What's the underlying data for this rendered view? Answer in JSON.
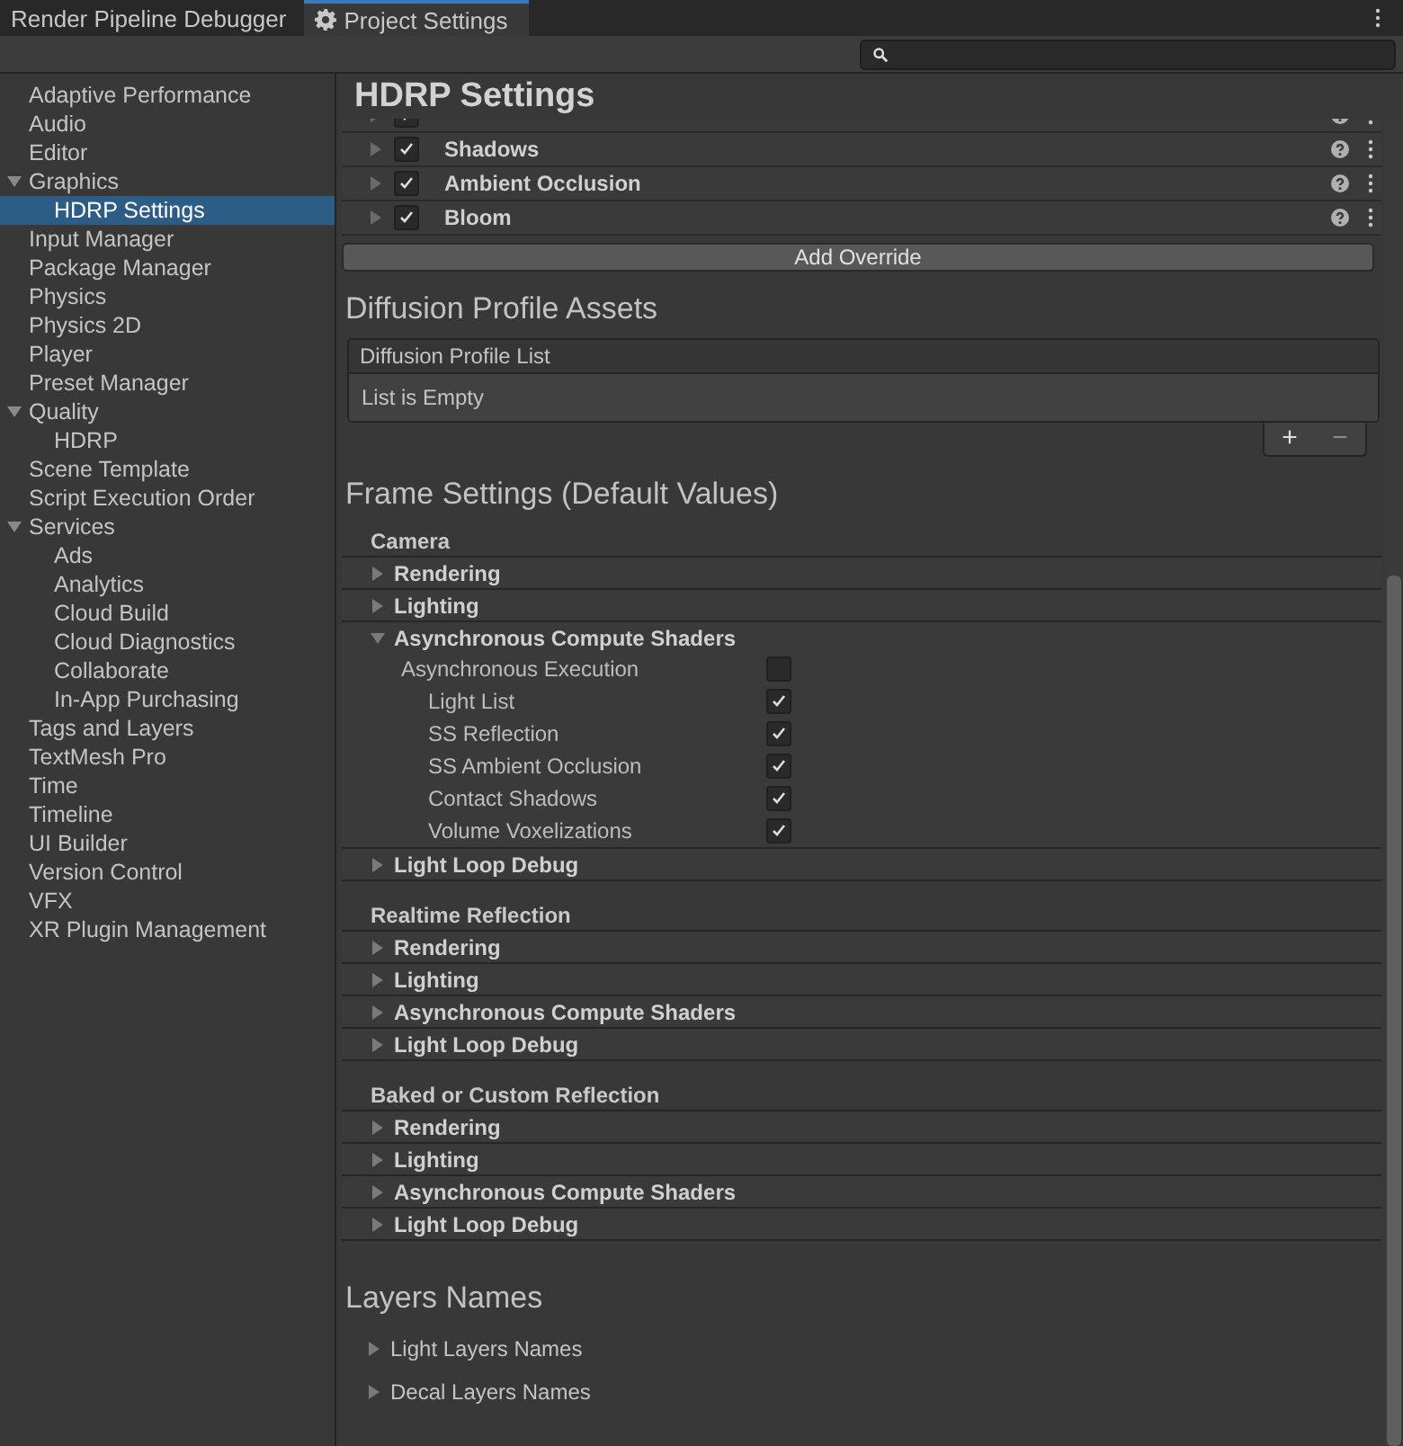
{
  "tabs": [
    {
      "label": "Render Pipeline Debugger",
      "selected": false,
      "kind": "plain"
    },
    {
      "label": "Project Settings",
      "selected": true,
      "kind": "settings"
    }
  ],
  "sidebar": {
    "items": [
      {
        "label": "Adaptive Performance",
        "selected": false
      },
      {
        "label": "Audio",
        "selected": false
      },
      {
        "label": "Editor",
        "selected": false
      },
      {
        "label": "Graphics",
        "selected": false,
        "expanded": true,
        "children": [
          {
            "label": "HDRP Settings",
            "selected": true
          }
        ]
      },
      {
        "label": "Input Manager",
        "selected": false
      },
      {
        "label": "Package Manager",
        "selected": false
      },
      {
        "label": "Physics",
        "selected": false
      },
      {
        "label": "Physics 2D",
        "selected": false
      },
      {
        "label": "Player",
        "selected": false
      },
      {
        "label": "Preset Manager",
        "selected": false
      },
      {
        "label": "Quality",
        "selected": false,
        "expanded": true,
        "children": [
          {
            "label": "HDRP",
            "selected": false
          }
        ]
      },
      {
        "label": "Scene Template",
        "selected": false
      },
      {
        "label": "Script Execution Order",
        "selected": false
      },
      {
        "label": "Services",
        "selected": false,
        "expanded": true,
        "children": [
          {
            "label": "Ads",
            "selected": false
          },
          {
            "label": "Analytics",
            "selected": false
          },
          {
            "label": "Cloud Build",
            "selected": false
          },
          {
            "label": "Cloud Diagnostics",
            "selected": false
          },
          {
            "label": "Collaborate",
            "selected": false
          },
          {
            "label": "In-App Purchasing",
            "selected": false
          }
        ]
      },
      {
        "label": "Tags and Layers",
        "selected": false
      },
      {
        "label": "TextMesh Pro",
        "selected": false
      },
      {
        "label": "Time",
        "selected": false
      },
      {
        "label": "Timeline",
        "selected": false
      },
      {
        "label": "UI Builder",
        "selected": false
      },
      {
        "label": "Version Control",
        "selected": false
      },
      {
        "label": "VFX",
        "selected": false
      },
      {
        "label": "XR Plugin Management",
        "selected": false
      }
    ]
  },
  "page_title": "HDRP Settings",
  "overrides": [
    {
      "checked": true,
      "kind": "clipped"
    },
    {
      "label": "Shadows",
      "checked": true,
      "kind": "full"
    },
    {
      "label": "Ambient Occlusion",
      "checked": true,
      "kind": "full"
    },
    {
      "label": "Bloom",
      "checked": true,
      "kind": "full"
    }
  ],
  "add_override": "Add Override",
  "diffusion": {
    "title": "Diffusion Profile Assets",
    "list_header": "Diffusion Profile List",
    "empty_text": "List is Empty",
    "add": "+",
    "remove": "−"
  },
  "frame_settings": {
    "title": "Frame Settings (Default Values)",
    "groups": [
      {
        "title": "Camera",
        "foldouts": [
          {
            "label": "Rendering",
            "expanded": false
          },
          {
            "label": "Lighting",
            "expanded": false
          },
          {
            "label": "Asynchronous Compute Shaders",
            "expanded": true,
            "children": [
              {
                "label": "Asynchronous Execution",
                "checked": false,
                "children": [
                  {
                    "label": "Light List",
                    "checked": true
                  },
                  {
                    "label": "SS Reflection",
                    "checked": true
                  },
                  {
                    "label": "SS Ambient Occlusion",
                    "checked": true
                  },
                  {
                    "label": "Contact Shadows",
                    "checked": true
                  },
                  {
                    "label": "Volume Voxelizations",
                    "checked": true
                  }
                ]
              }
            ]
          },
          {
            "label": "Light Loop Debug",
            "expanded": false
          }
        ]
      },
      {
        "title": "Realtime Reflection",
        "foldouts": [
          {
            "label": "Rendering",
            "expanded": false
          },
          {
            "label": "Lighting",
            "expanded": false
          },
          {
            "label": "Asynchronous Compute Shaders",
            "expanded": false
          },
          {
            "label": "Light Loop Debug",
            "expanded": false
          }
        ]
      },
      {
        "title": "Baked or Custom Reflection",
        "foldouts": [
          {
            "label": "Rendering",
            "expanded": false
          },
          {
            "label": "Lighting",
            "expanded": false
          },
          {
            "label": "Asynchronous Compute Shaders",
            "expanded": false
          },
          {
            "label": "Light Loop Debug",
            "expanded": false
          }
        ]
      }
    ]
  },
  "layers_names": {
    "title": "Layers Names",
    "items": [
      {
        "label": "Light Layers Names",
        "expanded": false
      },
      {
        "label": "Decal Layers Names",
        "expanded": false
      }
    ]
  }
}
